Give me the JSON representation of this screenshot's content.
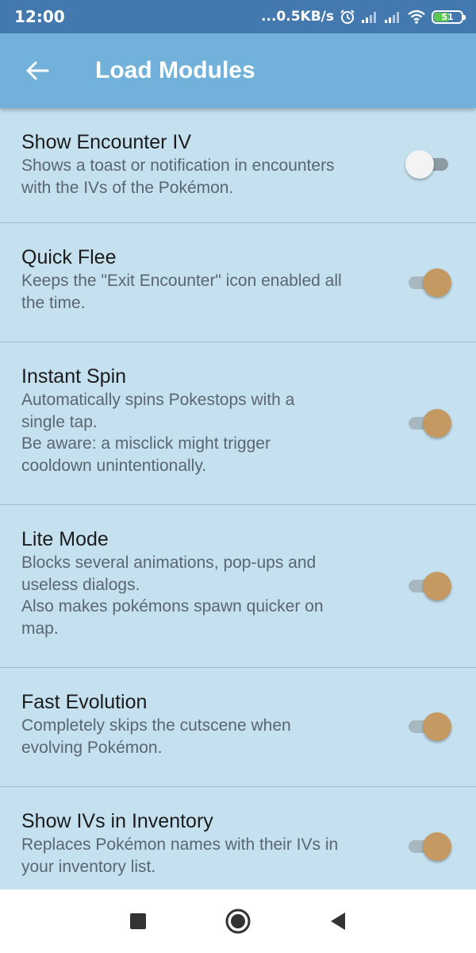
{
  "status": {
    "time": "12:00",
    "network_speed": "...0.5KB/s",
    "battery": "51",
    "colors": {
      "bar": "#4379ae",
      "battery_fill": "#5ec84e"
    }
  },
  "appbar": {
    "title": "Load Modules",
    "back_icon": "arrow-left-icon",
    "color": "#72b2da"
  },
  "modules": [
    {
      "title": "Show Encounter IV",
      "description": "Shows a toast or notification in encounters\nwith the IVs of the Pokémon.",
      "enabled": false
    },
    {
      "title": "Quick Flee",
      "description": "Keeps the \"Exit Encounter\" icon enabled all\nthe time.",
      "enabled": true
    },
    {
      "title": "Instant Spin",
      "description": "Automatically spins Pokestops with a\nsingle tap.\nBe aware: a misclick might trigger\ncooldown unintentionally.",
      "enabled": true
    },
    {
      "title": "Lite Mode",
      "description": "Blocks several animations, pop-ups and\nuseless dialogs.\nAlso makes pokémons spawn quicker on\nmap.",
      "enabled": true
    },
    {
      "title": "Fast Evolution",
      "description": "Completely skips the cutscene when\nevolving Pokémon.",
      "enabled": true
    },
    {
      "title": "Show IVs in Inventory",
      "description": "Replaces Pokémon names with their IVs in\nyour inventory list.",
      "enabled": true
    }
  ],
  "navbar": {
    "icons": [
      "recent-apps-icon",
      "home-icon",
      "back-triangle-icon"
    ]
  },
  "colors": {
    "list_background": "#c5e1f0",
    "switch_on_thumb": "#c59a62",
    "switch_off_thumb": "#f3f3f3"
  }
}
